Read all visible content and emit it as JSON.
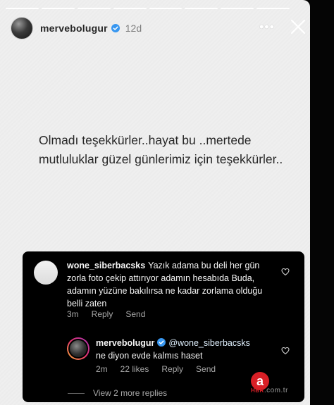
{
  "story": {
    "username": "mervebolugur",
    "time_ago": "12d",
    "more_glyph": "•••",
    "text": "Olmadı teşekkürler..hayat bu ..mertede mutluluklar güzel günlerimiz için teşekkürler..",
    "progress_segments": 8
  },
  "comments": {
    "items": [
      {
        "username": "wone_siberbacsks",
        "text": "Yazık adama bu deli her gün zorla foto çekip attırıyor adamın hesabıda Buda, adamın yüzüne bakılırsa ne kadar zorlama olduğu belli zaten",
        "time": "3m",
        "reply_label": "Reply",
        "send_label": "Send"
      },
      {
        "username": "mervebolugur",
        "mention": "@wone_siberbacsks",
        "text": "ne diyon evde kalmıs haset",
        "time": "2m",
        "likes": "22 likes",
        "reply_label": "Reply",
        "send_label": "Send"
      }
    ],
    "view_more": "View 2 more replies"
  },
  "watermark": {
    "letter": "a",
    "brand": "HBR",
    "domain": ".com.tr"
  },
  "colors": {
    "verified_blue": "#3897f0",
    "watermark_red": "#d81f26",
    "story_bg": "#efefef"
  },
  "icons": [
    "verified-badge-icon",
    "more-options-icon",
    "close-icon",
    "heart-icon"
  ]
}
